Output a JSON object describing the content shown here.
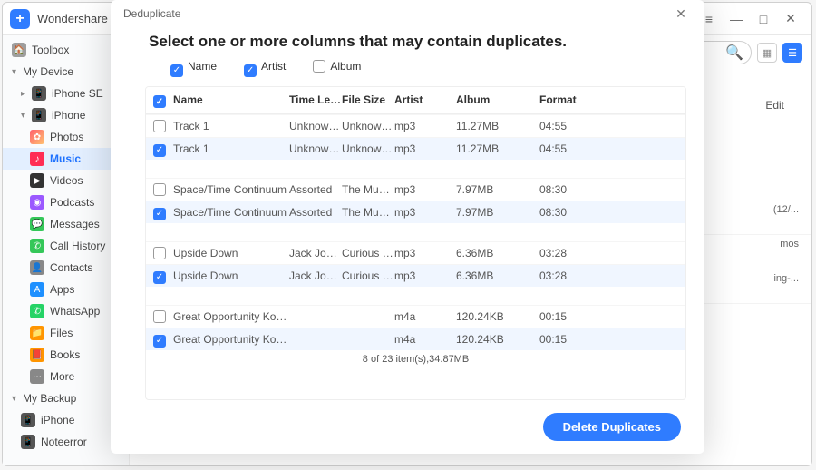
{
  "titlebar": {
    "app_name": "Wondershare Dr.Fon..."
  },
  "sidebar": {
    "toolbox": "Toolbox",
    "my_device": "My Device",
    "iphone_se": "iPhone SE",
    "iphone": "iPhone",
    "photos": "Photos",
    "music": "Music",
    "videos": "Videos",
    "podcasts": "Podcasts",
    "messages": "Messages",
    "call_history": "Call History",
    "contacts": "Contacts",
    "apps": "Apps",
    "whatsapp": "WhatsApp",
    "files": "Files",
    "books": "Books",
    "more": "More",
    "my_backup": "My Backup",
    "backup_iphone": "iPhone",
    "noteerror": "Noteerror"
  },
  "content": {
    "edit": "Edit",
    "bg_rows": [
      "(12/...",
      "mos",
      "ing-..."
    ]
  },
  "modal": {
    "header": "Deduplicate",
    "title": "Select one or more columns that may contain duplicates.",
    "col_name": "Name",
    "col_artist": "Artist",
    "col_album": "Album",
    "th": {
      "name": "Name",
      "time": "Time Len...",
      "fs": "File Size",
      "artist": "Artist",
      "album": "Album",
      "format": "Format"
    },
    "rows": [
      {
        "sel": false,
        "name": "Track 1",
        "time": "Unknown ...",
        "fs": "Unknown ...",
        "artist": "mp3",
        "album": "11.27MB",
        "fmt": "04:55"
      },
      {
        "sel": true,
        "name": "Track 1",
        "time": "Unknown ...",
        "fs": "Unknown ...",
        "artist": "mp3",
        "album": "11.27MB",
        "fmt": "04:55"
      },
      {
        "gap": true
      },
      {
        "sel": false,
        "name": "Space/Time Continuum",
        "time": "Assorted",
        "fs": "The Music...",
        "artist": "mp3",
        "album": "7.97MB",
        "fmt": "08:30"
      },
      {
        "sel": true,
        "name": "Space/Time Continuum",
        "time": "Assorted",
        "fs": "The Music...",
        "artist": "mp3",
        "album": "7.97MB",
        "fmt": "08:30"
      },
      {
        "gap": true
      },
      {
        "sel": false,
        "name": "Upside Down",
        "time": "Jack John...",
        "fs": "Curious G...",
        "artist": "mp3",
        "album": "6.36MB",
        "fmt": "03:28"
      },
      {
        "sel": true,
        "name": "Upside Down",
        "time": "Jack John...",
        "fs": "Curious G...",
        "artist": "mp3",
        "album": "6.36MB",
        "fmt": "03:28"
      },
      {
        "gap": true
      },
      {
        "sel": false,
        "name": "Great Opportunity Kouf...",
        "time": "",
        "fs": "",
        "artist": "m4a",
        "album": "120.24KB",
        "fmt": "00:15"
      },
      {
        "sel": true,
        "name": "Great Opportunity Kouf...",
        "time": "",
        "fs": "",
        "artist": "m4a",
        "album": "120.24KB",
        "fmt": "00:15"
      }
    ],
    "summary": "8 of 23 item(s),34.87MB",
    "delete_btn": "Delete Duplicates"
  }
}
